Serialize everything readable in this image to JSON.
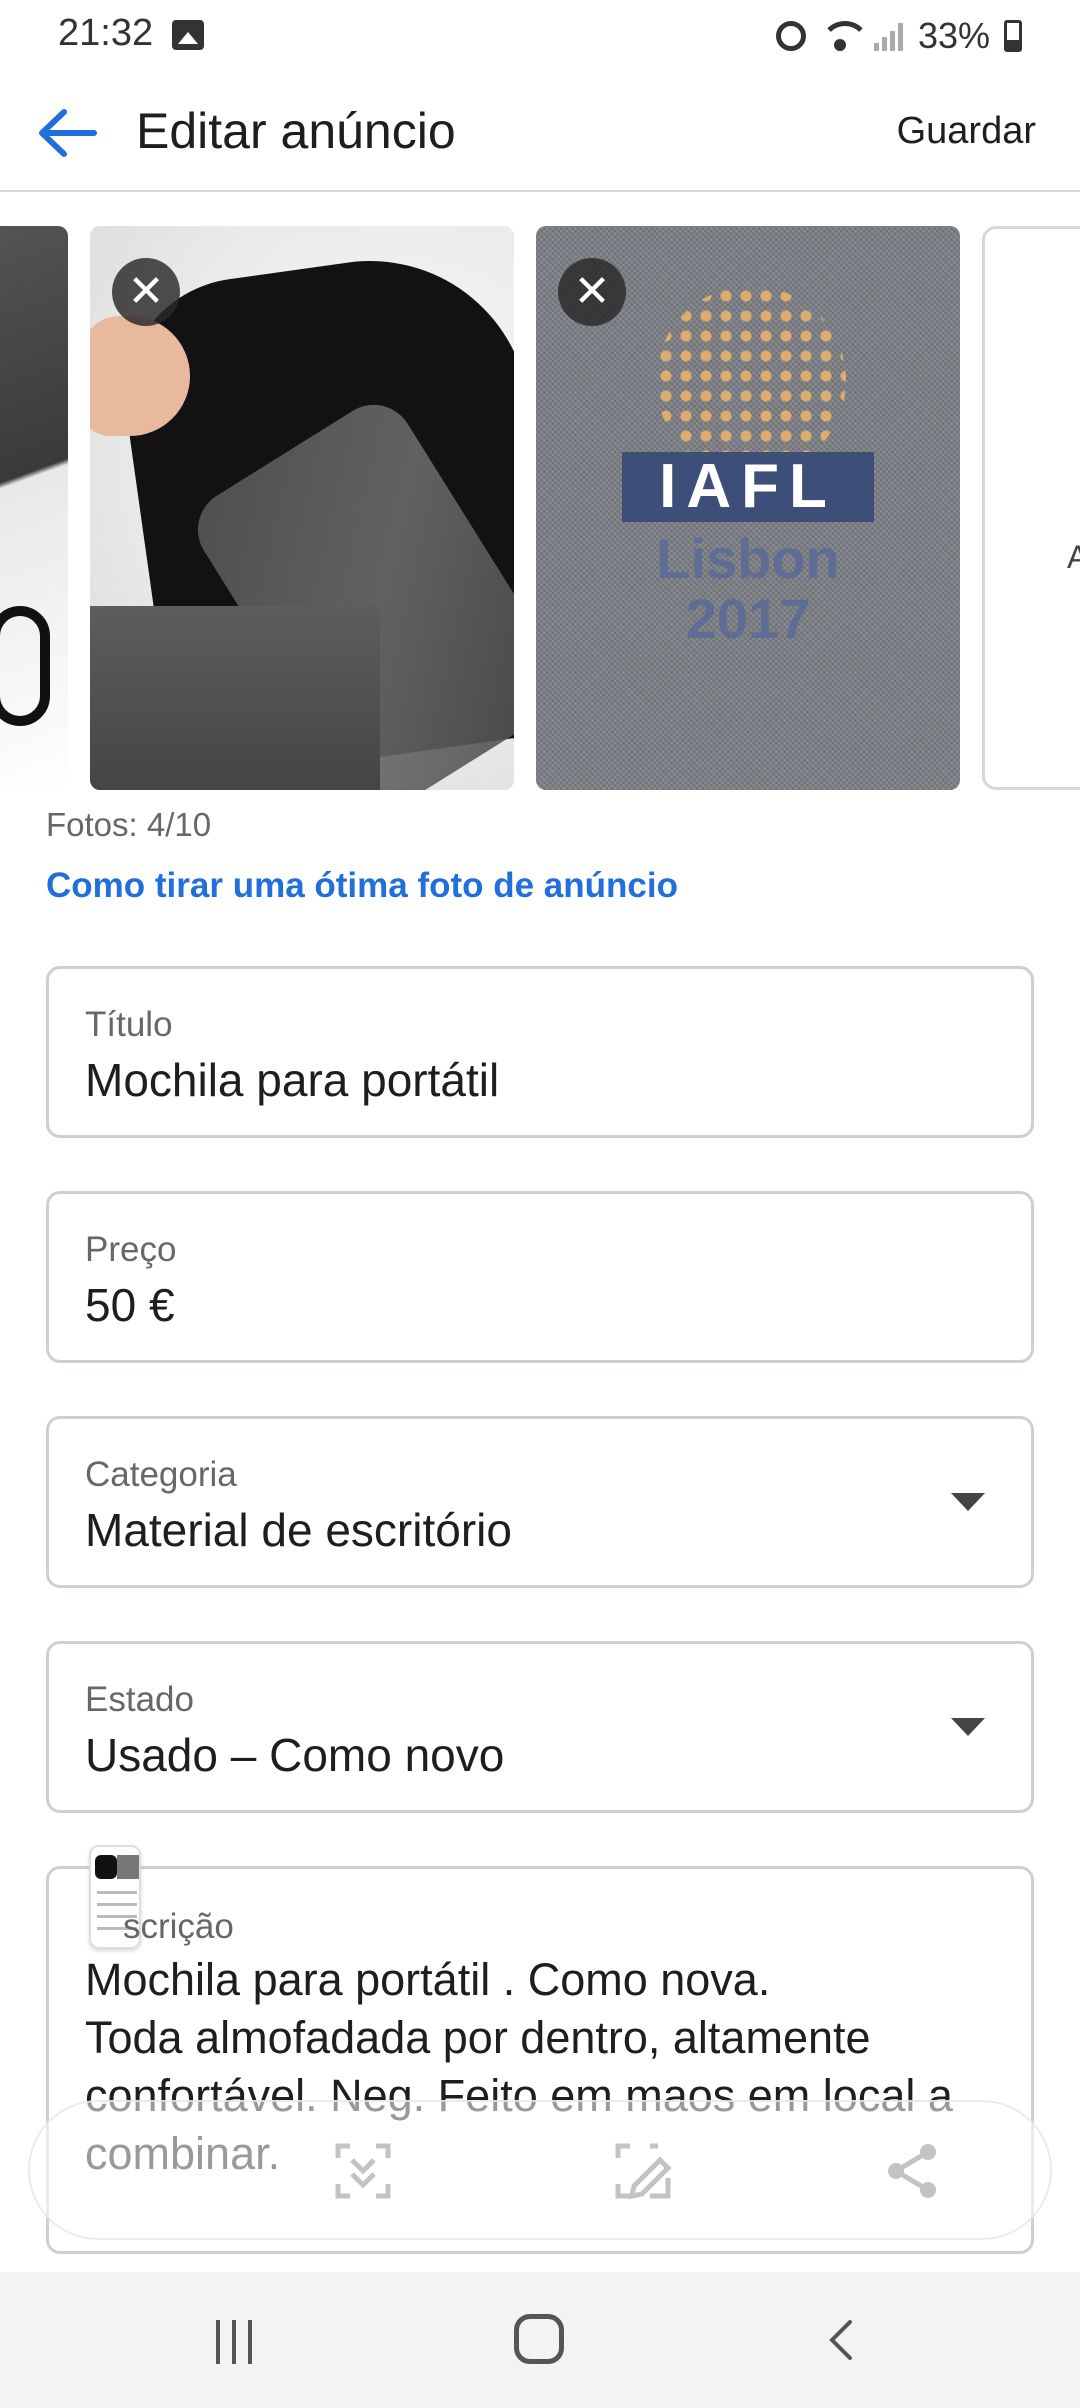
{
  "status_bar": {
    "time": "21:32",
    "battery": "33%",
    "icons": [
      "gallery-icon",
      "alarm-icon",
      "wifi-icon",
      "signal-icon",
      "battery-icon"
    ]
  },
  "header": {
    "title": "Editar anúncio",
    "save_label": "Guardar",
    "back_icon": "arrow-left-icon"
  },
  "photos": {
    "add_label": "A",
    "count_text": "Fotos: 4/10",
    "tip_link": "Como tirar uma ótima foto de anúncio",
    "items": [
      {
        "description": "backpack-side"
      },
      {
        "description": "backpack-open",
        "remove_symbol": "✕"
      },
      {
        "description": "iafl-logo",
        "remove_symbol": "✕",
        "logo": "IAFL",
        "logo_line2": "Lisbon",
        "logo_line3": "2017"
      }
    ]
  },
  "form": {
    "title": {
      "label": "Título",
      "value": "Mochila para portátil"
    },
    "price": {
      "label": "Preço",
      "value": "50 €"
    },
    "category": {
      "label": "Categoria",
      "value": "Material de escritório"
    },
    "condition": {
      "label": "Estado",
      "value": "Usado – Como novo"
    },
    "description": {
      "label": "scrição",
      "value": "Mochila para portátil . Como nova.\nToda almofadada por dentro, altamente confortável. Neg. Feito em maos em local a combinar."
    }
  },
  "colors": {
    "accent": "#216fdb",
    "text": "#1c1e21",
    "secondary_text": "#65676b",
    "border": "#ccd0d5"
  }
}
